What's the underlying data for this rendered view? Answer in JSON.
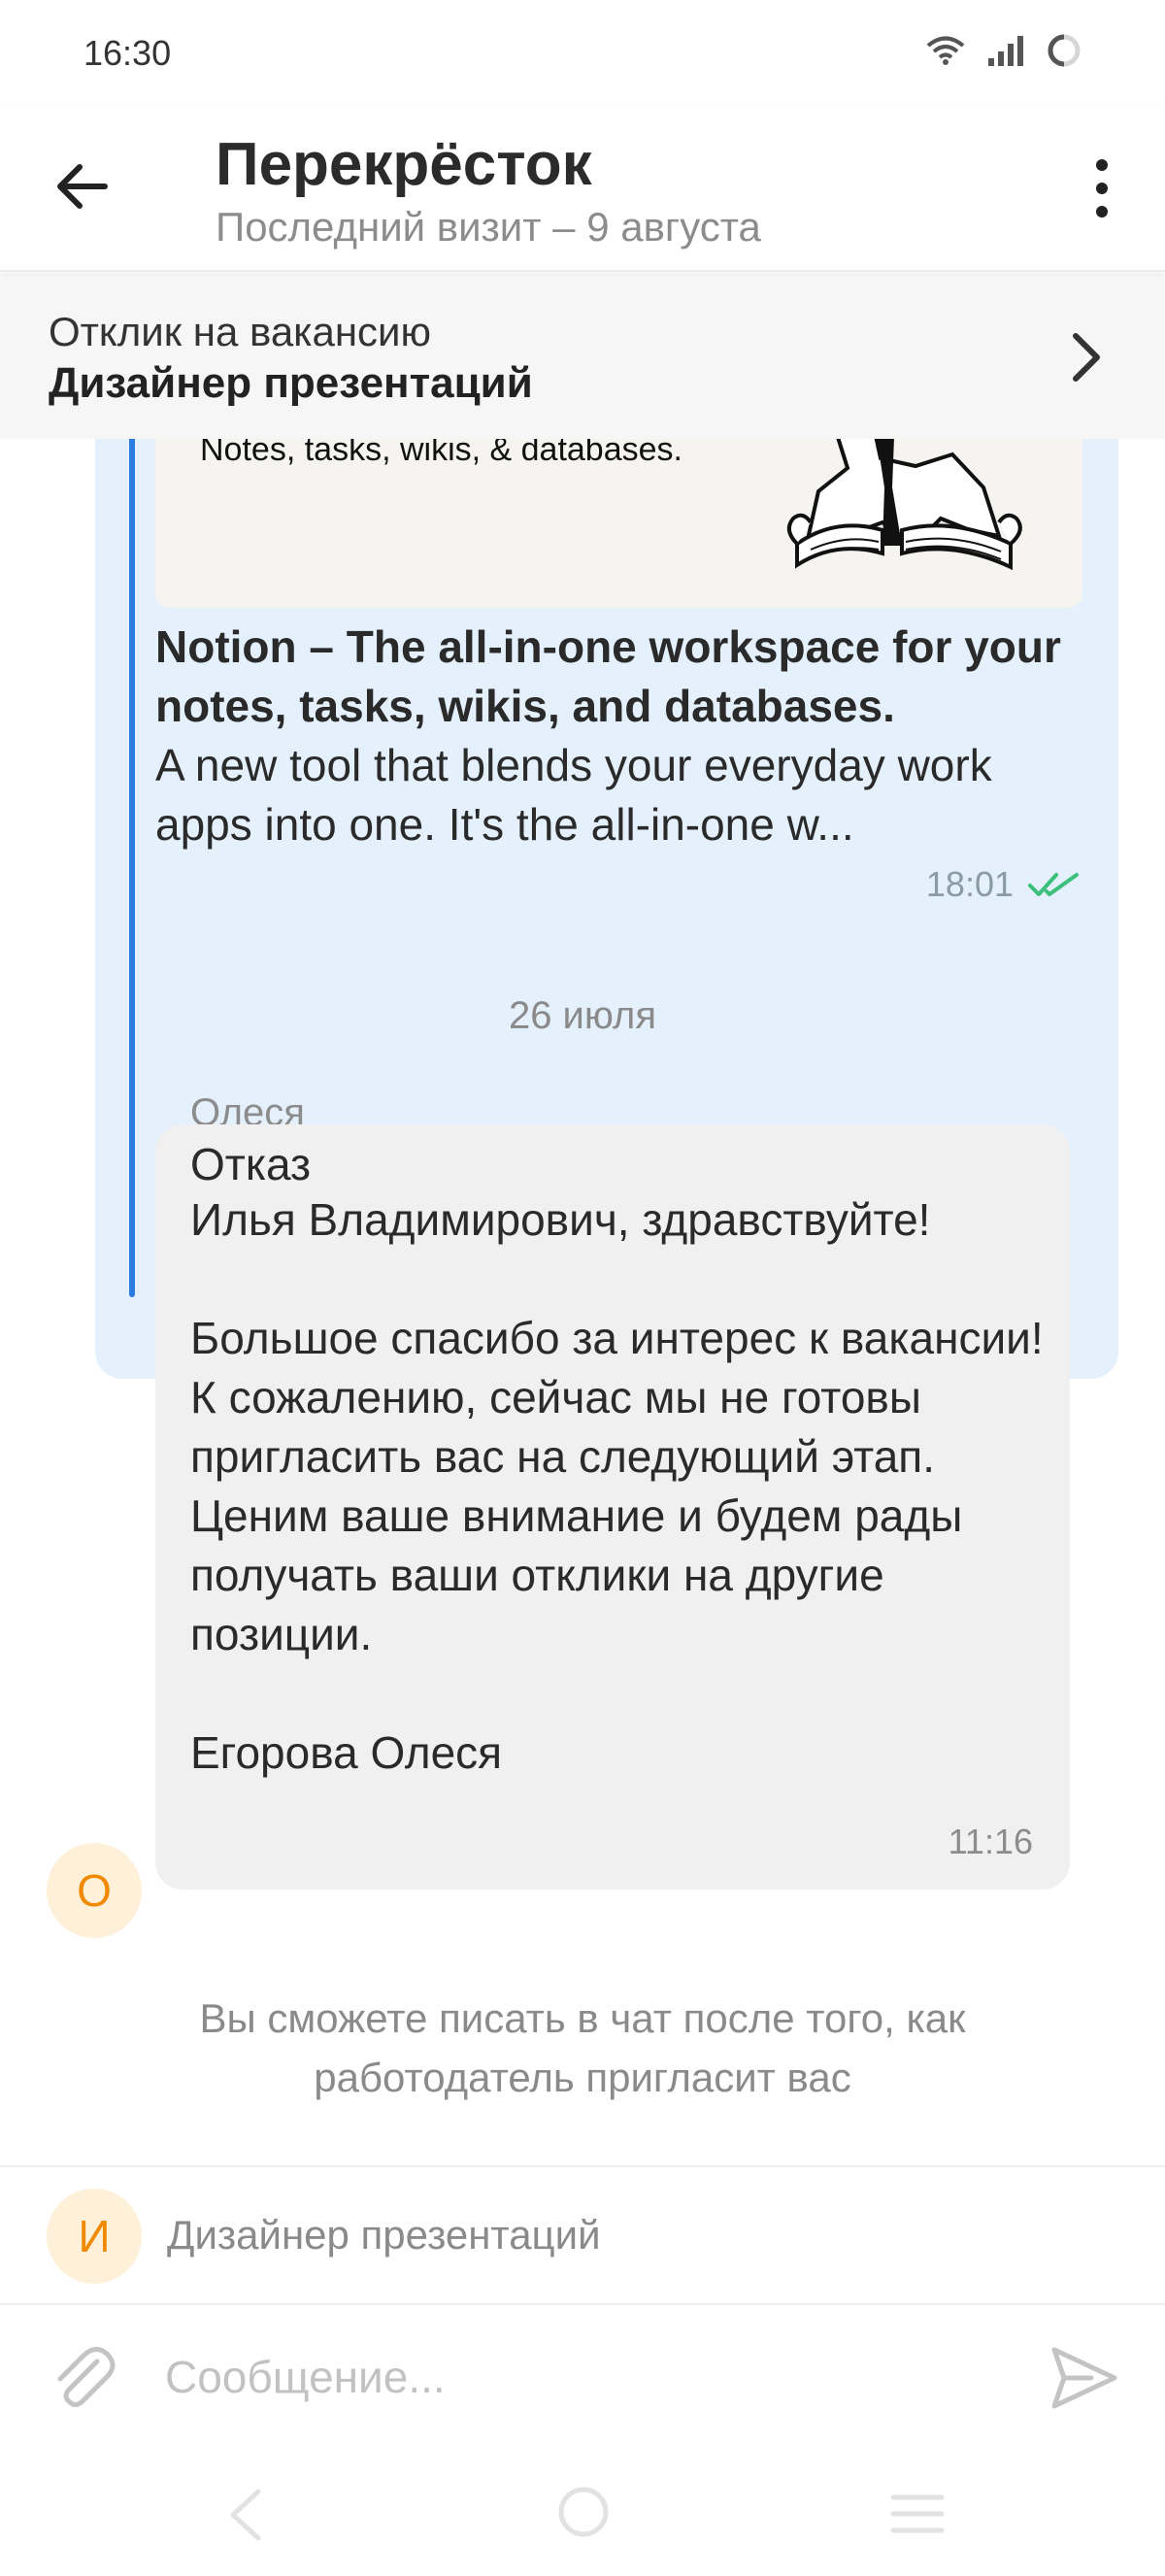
{
  "status_bar": {
    "time": "16:30"
  },
  "header": {
    "title": "Перекрёсток",
    "subtitle": "Последний визит – 9 августа"
  },
  "vacancy_banner": {
    "label": "Отклик на вакансию",
    "title": "Дизайнер презентаций"
  },
  "messages": {
    "sent": {
      "preview_caption": "Notes, tasks, wikis, & databases.",
      "link_title": "Notion – The all-in-one workspace for your notes, tasks, wikis, and databases.",
      "link_description": "A new tool that blends your everyday work apps into one. It's the all-in-one w...",
      "time": "18:01"
    },
    "date_separator": "26 июля",
    "received": {
      "sender": "Олеся",
      "avatar_letter": "О",
      "title": "Отказ",
      "body": "Илья Владимирович, здравствуйте!\n\nБольшое спасибо за интерес к вакансии! К сожалению, сейчас мы не готовы пригласить вас на следующий этап. Ценим ваше внимание и будем рады получать ваши отклики на другие позиции.\n\nЕгорова Олеся",
      "time": "11:16"
    }
  },
  "chat_notice": "Вы сможете писать в чат после того, как работодатель пригласит вас",
  "vacancy_row": {
    "avatar_letter": "И",
    "label": "Дизайнер презентаций"
  },
  "composer": {
    "placeholder": "Сообщение...",
    "value": ""
  },
  "colors": {
    "sent_bubble": "#e4f1fd",
    "quote_bar": "#2a7ce0",
    "received_bubble": "#f0f0f0",
    "avatar_bg": "#fff0d9",
    "avatar_letter": "#f08a00",
    "read_checks": "#3cbf7a"
  },
  "icons": {
    "back": "arrow-left-icon",
    "menu": "more-vertical-icon",
    "chevron": "chevron-right-icon",
    "attach": "paperclip-icon",
    "send": "send-icon",
    "read": "double-check-icon"
  }
}
